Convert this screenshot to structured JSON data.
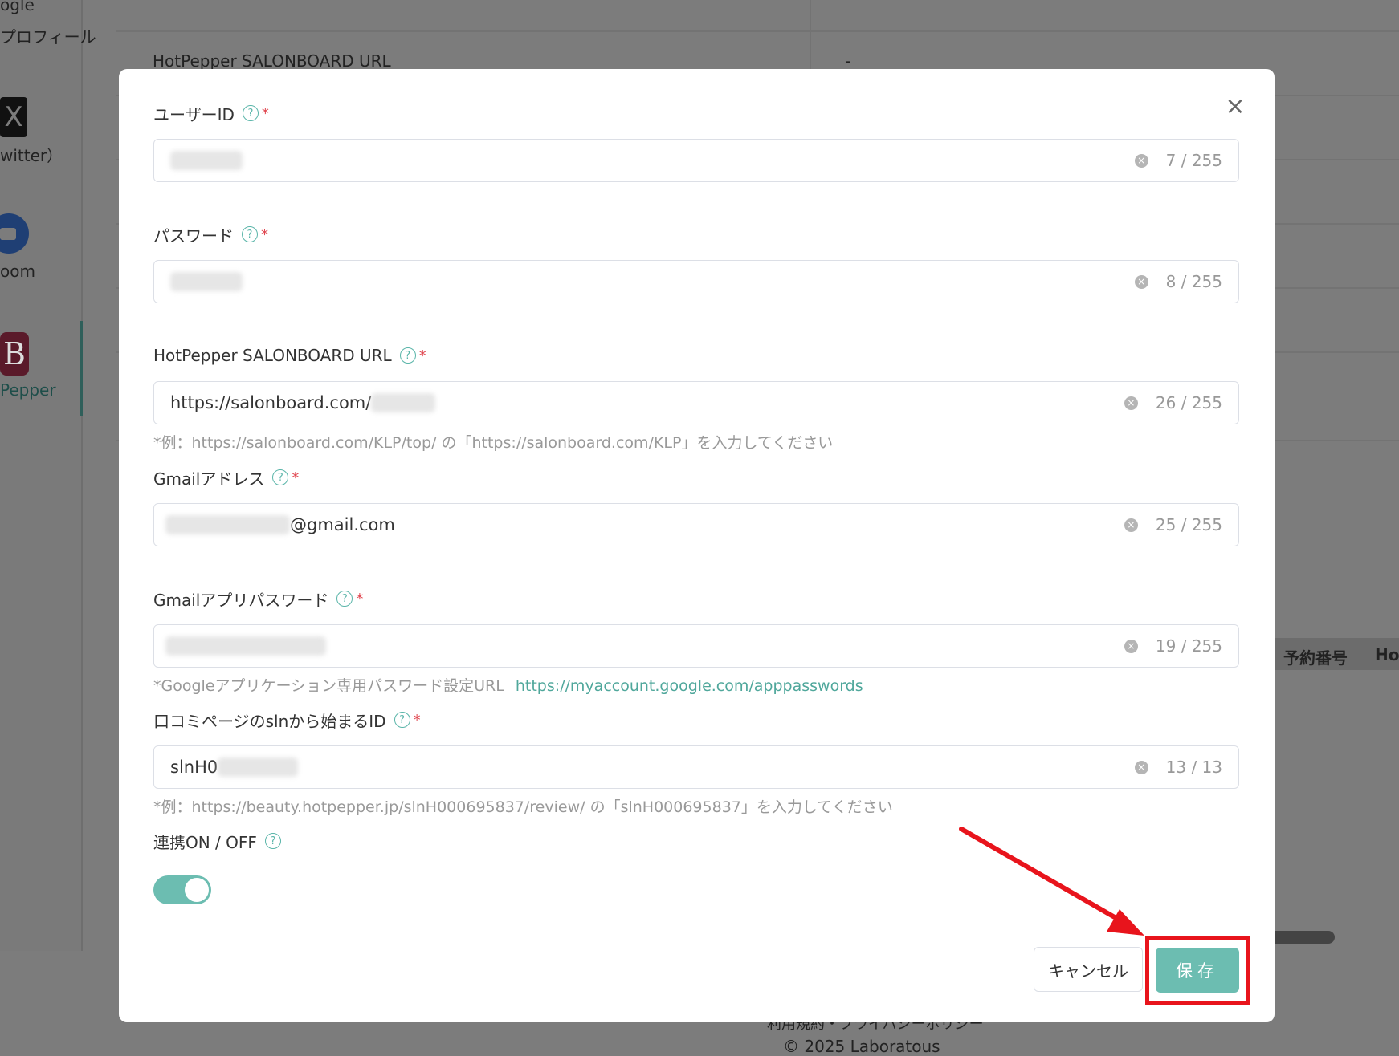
{
  "background": {
    "sidebar": [
      {
        "label": "ogle"
      },
      {
        "label": "プロフィール"
      },
      {
        "label": "witter）"
      },
      {
        "label": "oom"
      },
      {
        "label": "Pepper"
      }
    ],
    "row_label": "HotPepper SALONBOARD URL",
    "row_value": "-",
    "table_headers": [
      "予約番号",
      "Ho"
    ],
    "footer_links": "利用規約・プライバシーポリシー",
    "copyright": "© 2025 Laboratous"
  },
  "modal": {
    "fields": [
      {
        "label": "ユーザーID",
        "value": "",
        "count": "7 / 255"
      },
      {
        "label": "パスワード",
        "value": "",
        "count": "8 / 255"
      },
      {
        "label": "HotPepper SALONBOARD URL",
        "value": "https://salonboard.com/",
        "count": "26 / 255",
        "hint": "*例：https://salonboard.com/KLP/top/ の「https://salonboard.com/KLP」を入力してください"
      },
      {
        "label": "Gmailアドレス",
        "value": "@gmail.com",
        "count": "25 / 255"
      },
      {
        "label": "Gmailアプリパスワード",
        "value": "",
        "count": "19 / 255",
        "hint": "*Googleアプリケーション専用パスワード設定URL",
        "hint_link": "https://myaccount.google.com/apppasswords"
      },
      {
        "label": "口コミページのslnから始まるID",
        "value": "slnH0",
        "count": "13 / 13",
        "hint": "*例：https://beauty.hotpepper.jp/slnH000695837/review/ の「slnH000695837」を入力してください"
      }
    ],
    "toggle": {
      "label": "連携ON / OFF",
      "state": "on"
    },
    "required_mark": "*",
    "help_icon": "?",
    "close_icon": "×",
    "clear_icon": "×",
    "cancel_label": "キャンセル",
    "save_label": "保存"
  },
  "colors": {
    "accent": "#6cbdb1",
    "required": "#e0464f",
    "annotation": "#e8141c"
  }
}
